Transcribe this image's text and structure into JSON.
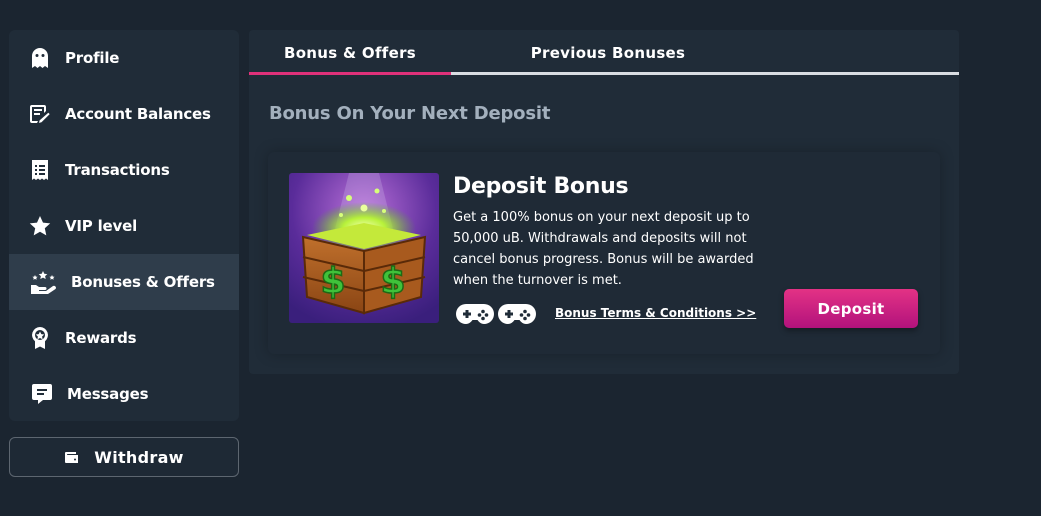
{
  "sidebar": {
    "items": [
      {
        "label": "Profile",
        "icon": "ghost-icon"
      },
      {
        "label": "Account Balances",
        "icon": "edit-note-icon"
      },
      {
        "label": "Transactions",
        "icon": "receipt-icon"
      },
      {
        "label": "VIP level",
        "icon": "star-icon"
      },
      {
        "label": "Bonuses & Offers",
        "icon": "hand-stars-icon",
        "active": true
      },
      {
        "label": "Rewards",
        "icon": "medal-icon"
      },
      {
        "label": "Messages",
        "icon": "chat-icon"
      }
    ],
    "withdraw_label": "Withdraw",
    "withdraw_icon": "wallet-icon"
  },
  "tabs": [
    {
      "label": "Bonus & Offers",
      "active": true
    },
    {
      "label": "Previous Bonuses",
      "active": false
    }
  ],
  "section_title": "Bonus On Your Next Deposit",
  "card": {
    "title": "Deposit Bonus",
    "description": "Get a 100% bonus on your next deposit up to 50,000 uB. Withdrawals and deposits will not cancel bonus progress. Bonus will be awarded when the turnover is met.",
    "terms_link": "Bonus Terms & Conditions >>",
    "deposit_label": "Deposit",
    "image_icon": "treasure-chest-icon",
    "game_icons": [
      "gamepad-icon",
      "gamepad-icon"
    ]
  },
  "colors": {
    "background": "#1b2530",
    "panel": "#202c38",
    "active_item": "#2f3d4b",
    "accent": "#e0317a",
    "muted_text": "#a3b0bd"
  }
}
